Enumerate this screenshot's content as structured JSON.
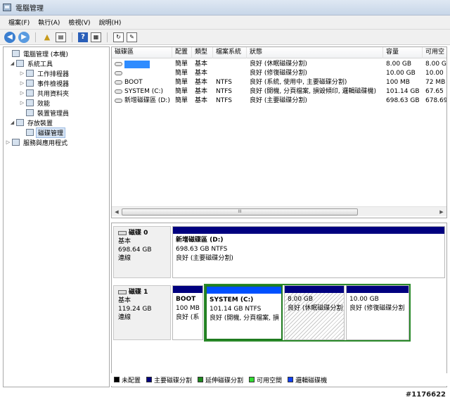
{
  "window": {
    "title": "電腦管理"
  },
  "menu": [
    "檔案(F)",
    "執行(A)",
    "檢視(V)",
    "說明(H)"
  ],
  "toolbar": {
    "help_glyph": "?"
  },
  "tree": [
    {
      "label": "電腦管理 (本機)",
      "icon": "computer-icon",
      "expander": ""
    },
    {
      "label": "系統工具",
      "icon": "tools-icon",
      "expander": "◢"
    },
    {
      "label": "工作排程器",
      "icon": "clock-icon",
      "expander": "▷"
    },
    {
      "label": "事件檢視器",
      "icon": "event-viewer-icon",
      "expander": "▷"
    },
    {
      "label": "共用資料夾",
      "icon": "shared-folder-icon",
      "expander": "▷"
    },
    {
      "label": "效能",
      "icon": "performance-icon",
      "expander": "▷"
    },
    {
      "label": "裝置管理員",
      "icon": "device-manager-icon",
      "expander": ""
    },
    {
      "label": "存放裝置",
      "icon": "storage-icon",
      "expander": "◢"
    },
    {
      "label": "磁碟管理",
      "icon": "disk-management-icon",
      "expander": ""
    },
    {
      "label": "服務與應用程式",
      "icon": "services-icon",
      "expander": "▷"
    }
  ],
  "columns": [
    "磁碟區",
    "配置",
    "類型",
    "檔案系統",
    "狀態",
    "容量",
    "可用空"
  ],
  "volumes": [
    {
      "name": "",
      "layout": "簡單",
      "type": "基本",
      "fs": "",
      "status": "良好 (休眠磁碟分割)",
      "capacity": "8.00 GB",
      "free": "8.00 G",
      "redacted": true
    },
    {
      "name": "",
      "layout": "簡單",
      "type": "基本",
      "fs": "",
      "status": "良好 (修復磁碟分割)",
      "capacity": "10.00 GB",
      "free": "10.00",
      "redacted": false
    },
    {
      "name": "BOOT",
      "layout": "簡單",
      "type": "基本",
      "fs": "NTFS",
      "status": "良好 (系統, 使用中, 主要磁碟分割)",
      "capacity": "100 MB",
      "free": "72 MB",
      "redacted": false
    },
    {
      "name": "SYSTEM (C:)",
      "layout": "簡單",
      "type": "基本",
      "fs": "NTFS",
      "status": "良好 (開機, 分頁檔案, 損毀傾印, 邏輯磁碟機)",
      "capacity": "101.14 GB",
      "free": "67.65",
      "redacted": false
    },
    {
      "name": "新增磁碟區 (D:)",
      "layout": "簡單",
      "type": "基本",
      "fs": "NTFS",
      "status": "良好 (主要磁碟分割)",
      "capacity": "698.63 GB",
      "free": "678.69",
      "redacted": false
    }
  ],
  "scrollbar": {
    "grip": "III"
  },
  "disks": [
    {
      "name": "磁碟 0",
      "kind": "基本",
      "size": "698.64 GB",
      "state": "連線",
      "partitions": [
        {
          "title": "新增磁碟區 (D:)",
          "line2": "698.63 GB NTFS",
          "line3": "良好 (主要磁碟分割)"
        }
      ]
    },
    {
      "name": "磁碟 1",
      "kind": "基本",
      "size": "119.24 GB",
      "state": "連線",
      "partitions": [
        {
          "title": "BOOT",
          "line2": "100 MB",
          "line3": "良好 (系"
        },
        {
          "title": "SYSTEM (C:)",
          "line2": "101.14 GB NTFS",
          "line3": "良好 (開機, 分頁檔案, 損"
        },
        {
          "title": "",
          "line2": "8.00 GB",
          "line3": "良好 (休眠磁碟分割"
        },
        {
          "title": "",
          "line2": "10.00 GB",
          "line3": "良好 (修復磁碟分割"
        }
      ]
    }
  ],
  "legend": [
    {
      "label": "未配置",
      "color": "#000000"
    },
    {
      "label": "主要磁碟分割",
      "color": "#00007f"
    },
    {
      "label": "延伸磁碟分割",
      "color": "#1f8a1f"
    },
    {
      "label": "可用空間",
      "color": "#33dd33"
    },
    {
      "label": "邏輯磁碟機",
      "color": "#1040ff"
    }
  ],
  "watermark": "#1176622"
}
